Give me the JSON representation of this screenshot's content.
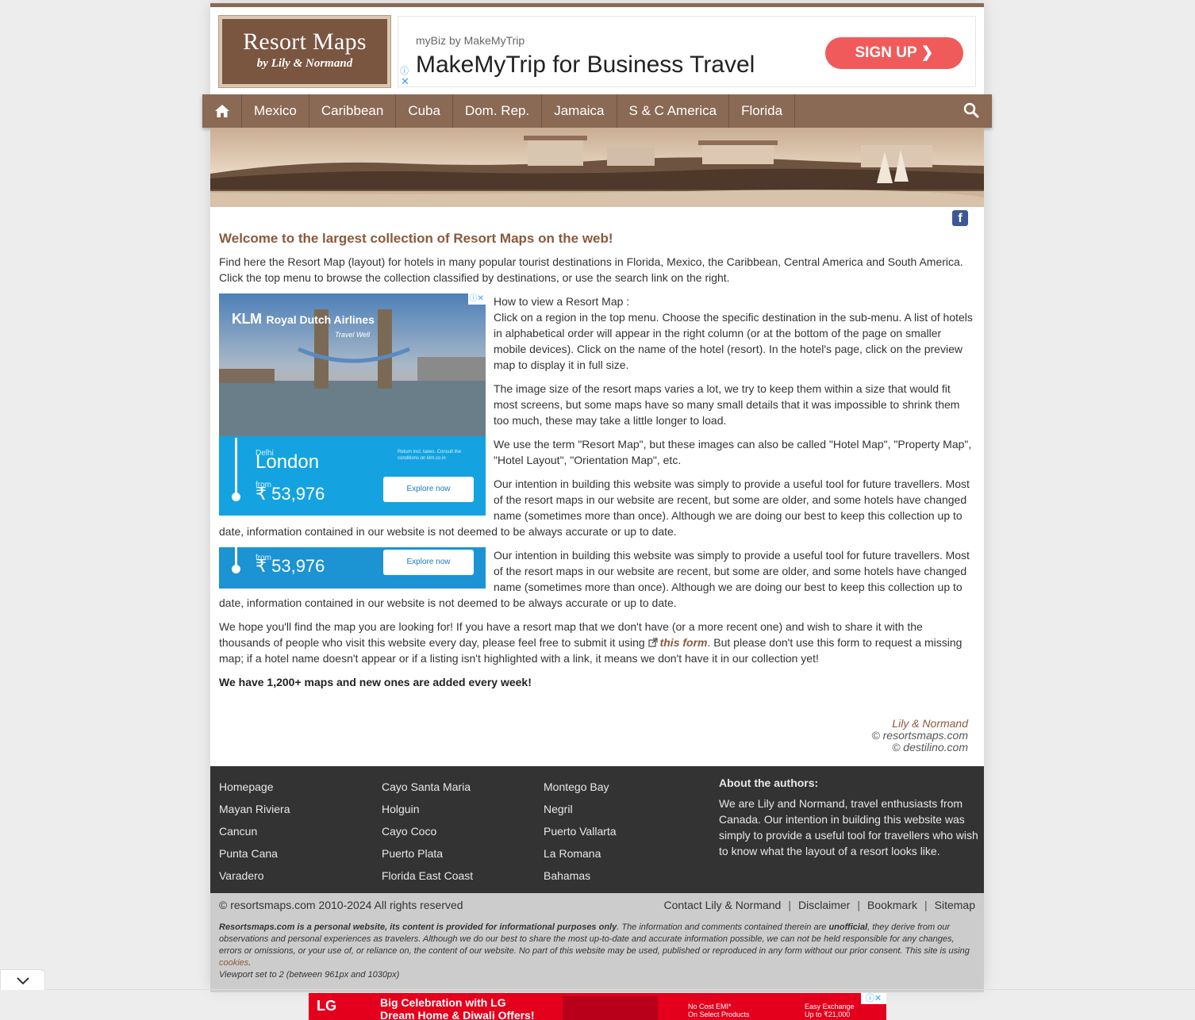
{
  "logo": {
    "line1": "Resort Maps",
    "line2": "by Lily & Normand"
  },
  "top_ad": {
    "sub": "myBiz by MakeMyTrip",
    "headline": "MakeMyTrip for Business Travel",
    "cta": "SIGN UP ❯",
    "info": "ⓘ",
    "close": "✕"
  },
  "nav": {
    "items": [
      "Mexico",
      "Caribbean",
      "Cuba",
      "Dom. Rep.",
      "Jamaica",
      "S & C America",
      "Florida"
    ],
    "home_icon": "home-icon",
    "search_icon": "search-icon"
  },
  "social": {
    "facebook": "f"
  },
  "content": {
    "heading": "Welcome to the largest collection of Resort Maps on the web!",
    "intro": "Find here the Resort Map (layout) for hotels in many popular tourist destinations in Florida, Mexico, the Caribbean, Central America and South America. Click the top menu to browse the collection classified by destinations, or use the search link on the right.",
    "howto_title": "How to view a Resort Map :",
    "howto_body": "Click on a region in the top menu. Choose the specific destination in the sub-menu. A list of hotels in alphabetical order will appear in the right column (or at the bottom of the page on smaller mobile devices). Click on the name of the hotel (resort). In the hotel's page, click on the preview map to display it in full size.",
    "p_size": "The image size of the resort maps varies a lot, we try to keep them within a size that would fit most screens, but some maps have so many small details that it was impossible to shrink them too much, these may take a little longer to load.",
    "p_term": "We use the term \"Resort Map\", but these images can also be called \"Hotel Map\", \"Property Map\", \"Hotel Layout\", \"Orientation Map\", etc.",
    "p_intention": "Our intention in building this website was simply to provide a useful tool for future travellers. Most of the resort maps in our website are recent, but some are older, and some hotels have changed name (sometimes more than once). Although we are doing our best to keep this collection up to date, information contained in our website is not deemed to be always accurate or up to date.",
    "p_hope_a": "We hope you'll find the map you are looking for! If you have a resort map that we don't have (or a more recent one) and wish to share it with the thousands of people who visit this website every day, please feel free to submit it using ",
    "p_hope_link": "this form",
    "p_hope_b": ". But please don't use this form to request a missing map; if a hotel name doesn't appear or if a listing isn't highlighted with a link, it means we don't have it in our collection yet!",
    "p_count": "We have 1,200+ maps and new ones are added every week!"
  },
  "klm_ad": {
    "brand": "KLM",
    "airline": "Royal Dutch Airlines",
    "tagline": "Travel Well",
    "origin": "Delhi",
    "destination": "London",
    "from": "from",
    "price": "₹ 53,976",
    "terms": "Return incl. taxes. Consult the conditions on klm.co.in",
    "cta": "Explore now",
    "adchoice": "ⓘ✕"
  },
  "signature": {
    "names": "Lily & Normand",
    "site1": "© resortsmaps.com",
    "site2": "© destilino.com"
  },
  "footer": {
    "col1": [
      "Homepage",
      "Mayan Riviera",
      "Cancun",
      "Punta Cana",
      "Varadero"
    ],
    "col2": [
      "Cayo Santa Maria",
      "Holguin",
      "Cayo Coco",
      "Puerto Plata",
      "Florida East Coast"
    ],
    "col3": [
      "Montego Bay",
      "Negril",
      "Puerto Vallarta",
      "La Romana",
      "Bahamas"
    ],
    "about_title": "About the authors:",
    "about_text": "We are Lily and Normand, travel enthusiasts from Canada. Our intention in building this website was simply to provide a useful tool for travellers who wish to know what the layout of a resort looks like.",
    "copyright": "© resortsmaps.com 2010-2024 All rights reserved",
    "links": [
      "Contact Lily & Normand",
      "Disclaimer",
      "Bookmark",
      "Sitemap"
    ],
    "legal_bold": "Resortsmaps.com is a personal website, its content is provided for informational purposes only",
    "legal_a": ". The information and comments contained therein are ",
    "legal_unofficial": "unofficial",
    "legal_b": ", they derive from our observations and personal experiences as travelers. Although we do our best to share the most up-to-date and accurate information possible, we can not be held responsible for any changes, errors or omissions, or your use of, or reliance on, the content of our website. No part of this website may be used, published or reproduced in any form without our prior consent. This site is using ",
    "legal_cookies": "cookies",
    "legal_c": ".",
    "viewport": "Viewport set to 2 (between 961px and 1030px)"
  },
  "bottom_ad": {
    "brand": "LG",
    "line1": "Big Celebration with LG",
    "line2": "Dream Home & Diwali Offers!",
    "emi1": "No Cost EMI*",
    "emi2": "On Select Products",
    "ex1": "Easy Exchange",
    "ex2": "Up to ₹21,000",
    "close": "ⓘ✕"
  },
  "colors": {
    "brand_brown": "#8a6a55",
    "heading_brown": "#8a5a3c",
    "klm_blue": "#14a3e0",
    "signup_red": "#f05a5a",
    "lg_red": "#e4001c"
  }
}
